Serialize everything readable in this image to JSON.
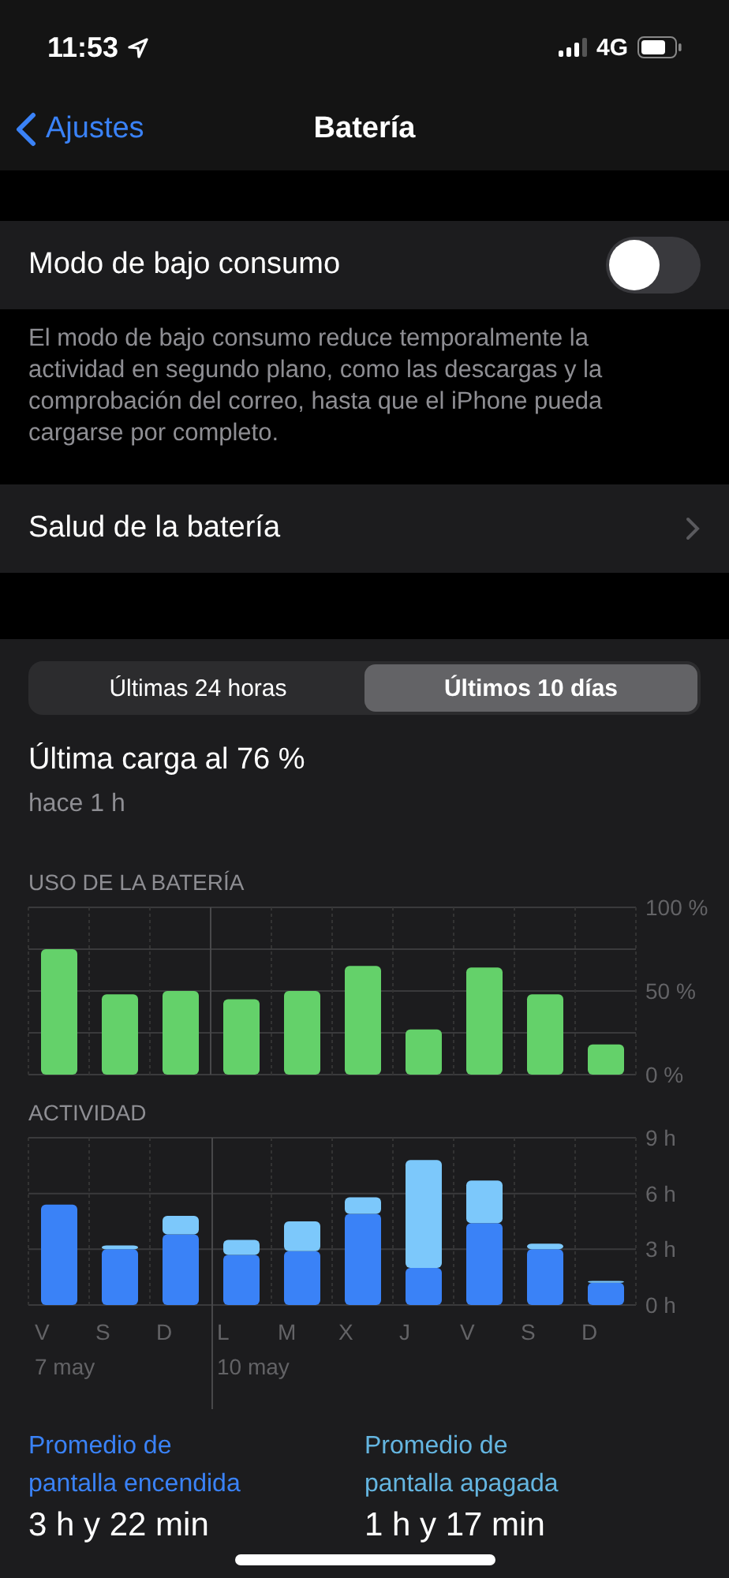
{
  "status_bar": {
    "time": "11:53",
    "network": "4G"
  },
  "nav": {
    "back": "Ajustes",
    "title": "Batería"
  },
  "low_power": {
    "label": "Modo de bajo consumo",
    "on": false,
    "description": "El modo de bajo consumo reduce temporalmente la actividad en segundo plano, como las descargas y la comprobación del correo, hasta que el iPhone pueda cargarse por completo."
  },
  "health": {
    "label": "Salud de la batería"
  },
  "range_tabs": [
    {
      "label": "Últimas 24 horas",
      "selected": false
    },
    {
      "label": "Últimos 10 días",
      "selected": true
    }
  ],
  "last_charge": {
    "title": "Última carga al 76 %",
    "time": "hace 1 h"
  },
  "usage": {
    "title": "USO DE LA BATERÍA",
    "chart_data": {
      "type": "bar",
      "ylim": [
        0,
        100
      ],
      "yticks": [
        {
          "value": 0,
          "label": "0 %"
        },
        {
          "value": 50,
          "label": "50 %"
        },
        {
          "value": 100,
          "label": "100 %"
        }
      ],
      "series": [
        {
          "color": "#64d16a",
          "values": [
            75,
            48,
            50,
            45,
            50,
            65,
            27,
            64,
            48,
            18
          ]
        }
      ]
    }
  },
  "activity": {
    "title": "ACTIVIDAD",
    "chart_data": {
      "type": "bar",
      "stacked": true,
      "categories": [
        "V",
        "S",
        "D",
        "L",
        "M",
        "X",
        "J",
        "V",
        "S",
        "D"
      ],
      "ylim": [
        0,
        9
      ],
      "yticks": [
        {
          "value": 0,
          "label": "0 h"
        },
        {
          "value": 3,
          "label": "3 h"
        },
        {
          "value": 6,
          "label": "6 h"
        },
        {
          "value": 9,
          "label": "9 h"
        }
      ],
      "series": [
        {
          "color": "#3a82f7",
          "values": [
            5.4,
            3.0,
            3.8,
            2.7,
            2.9,
            4.9,
            2.0,
            4.4,
            3.0,
            1.2
          ]
        },
        {
          "color": "#7cc8fb",
          "values": [
            0,
            0.2,
            1.0,
            0.8,
            1.6,
            0.9,
            5.8,
            2.3,
            0.3,
            0.1
          ]
        }
      ],
      "annotations": [
        "7 may",
        "10 may"
      ]
    }
  },
  "averages": [
    {
      "label": "Promedio de pantalla encendida",
      "value": "3 h y 22 min",
      "color": "#3a82f7"
    },
    {
      "label": "Promedio de pantalla apagada",
      "value": "1 h y 17 min",
      "color": "#64b5e0"
    }
  ]
}
